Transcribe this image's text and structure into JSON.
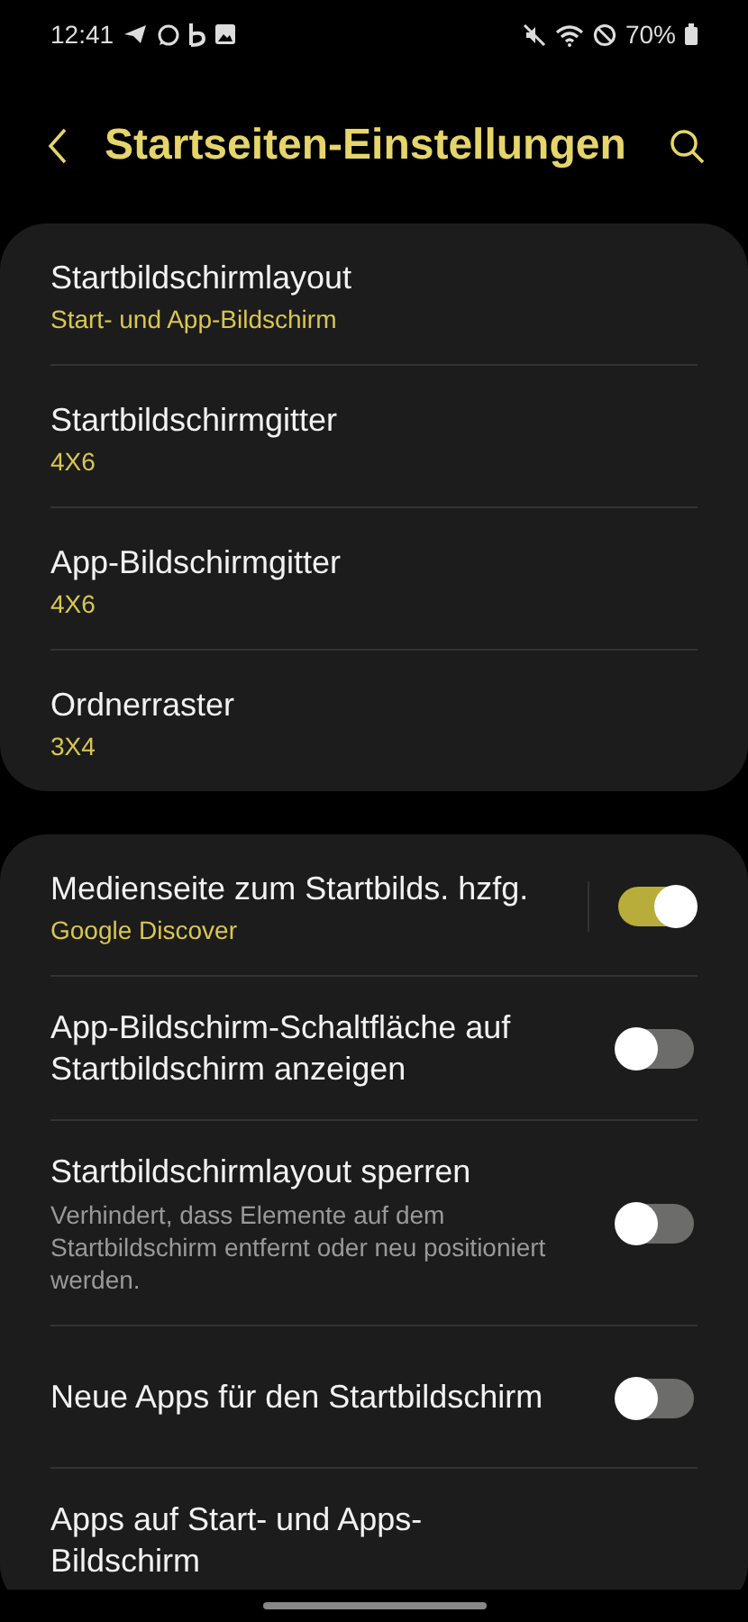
{
  "status_bar": {
    "time": "12:41",
    "battery": "70%"
  },
  "header": {
    "title": "Startseiten-Einstellungen"
  },
  "groups": [
    {
      "items": [
        {
          "kind": "link",
          "title": "Startbildschirmlayout",
          "value": "Start- und App-Bildschirm"
        },
        {
          "kind": "link",
          "title": "Startbildschirmgitter",
          "value": "4X6"
        },
        {
          "kind": "link",
          "title": "App-Bildschirmgitter",
          "value": "4X6"
        },
        {
          "kind": "link",
          "title": "Ordnerraster",
          "value": "3X4"
        }
      ]
    },
    {
      "items": [
        {
          "kind": "switch",
          "title": "Medienseite zum Startbilds. hzfg.",
          "value": "Google Discover",
          "on": true,
          "divider": true
        },
        {
          "kind": "switch",
          "title": "App-Bildschirm-Schaltfläche auf Startbildschirm anzeigen",
          "on": false,
          "divider": false
        },
        {
          "kind": "switch",
          "title": "Startbildschirmlayout sperren",
          "description": "Verhindert, dass Elemente auf dem Startbildschirm entfernt oder neu positioniert werden.",
          "on": false,
          "divider": false
        },
        {
          "kind": "switch",
          "title": "Neue Apps für den Startbildschirm",
          "on": false,
          "divider": false
        },
        {
          "kind": "link",
          "title": "Apps auf Start- und Apps-Bildschirm"
        }
      ]
    }
  ]
}
